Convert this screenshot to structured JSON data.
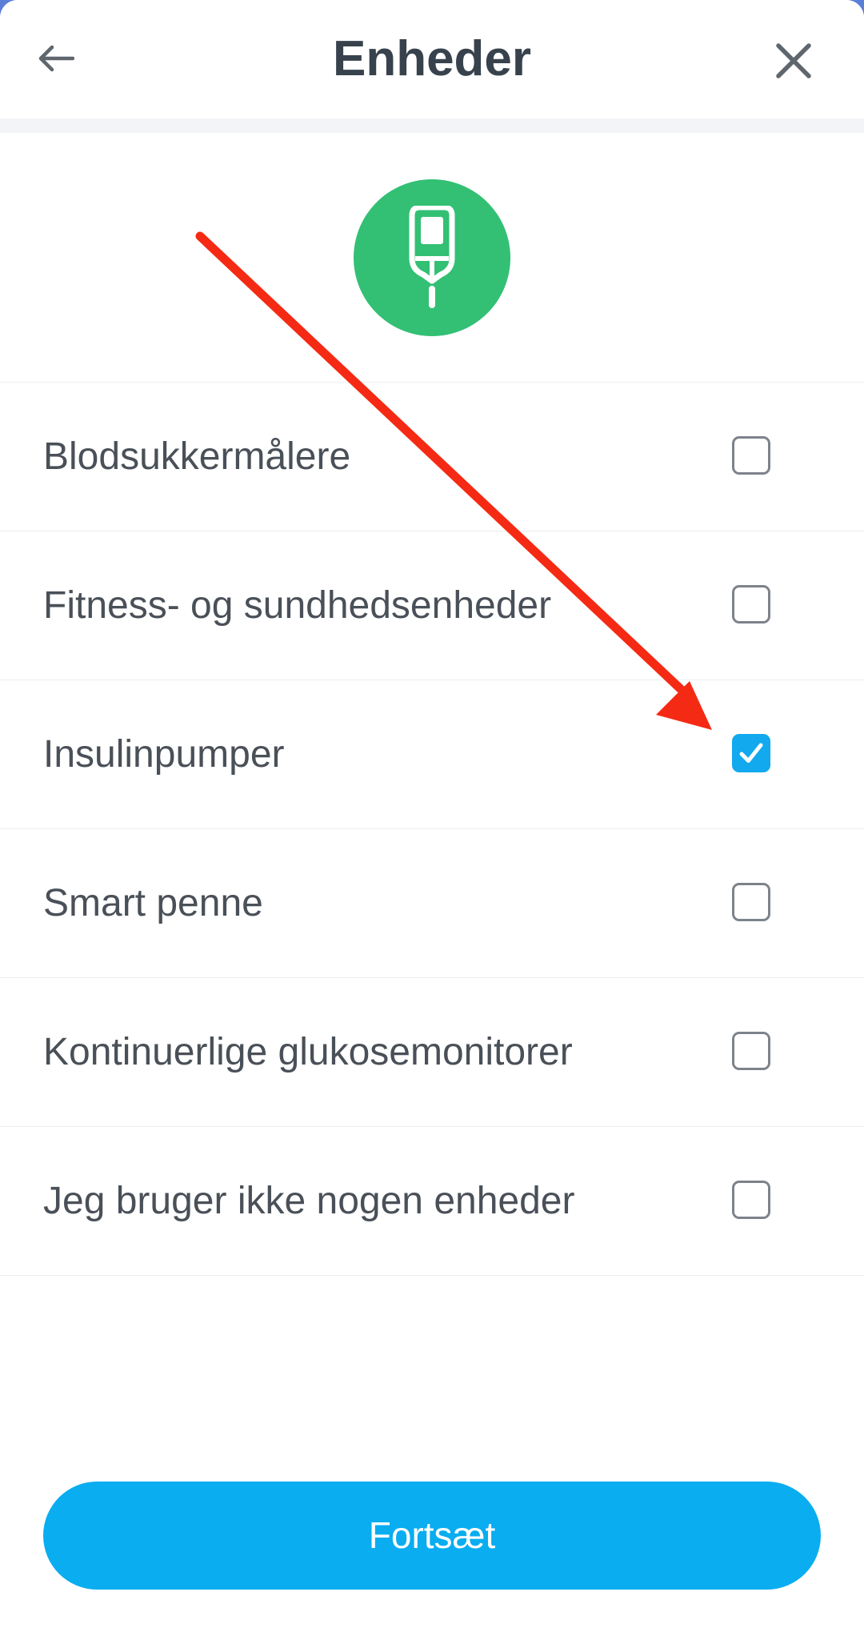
{
  "header": {
    "title": "Enheder",
    "back_icon": "arrow-left-icon",
    "close_icon": "close-icon"
  },
  "hero": {
    "icon": "glucose-meter-icon",
    "color": "#33c074"
  },
  "devices": [
    {
      "label": "Blodsukkermålere",
      "checked": false
    },
    {
      "label": "Fitness- og sundhedsenheder",
      "checked": false
    },
    {
      "label": "Insulinpumper",
      "checked": true
    },
    {
      "label": "Smart penne",
      "checked": false
    },
    {
      "label": "Kontinuerlige glukosemonitorer",
      "checked": false
    },
    {
      "label": "Jeg bruger ikke nogen enheder",
      "checked": false
    }
  ],
  "footer": {
    "continue_label": "Fortsæt"
  },
  "colors": {
    "accent": "#09adf0",
    "checkbox_checked": "#12a9ee",
    "annotation_arrow": "#f52a14"
  }
}
